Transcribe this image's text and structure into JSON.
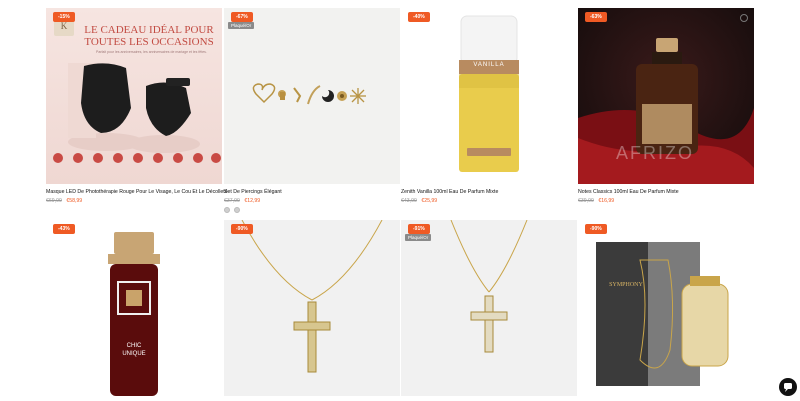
{
  "products": [
    {
      "discount": "-15%",
      "title": "Masque LED De Photothérapie Rouge Pour Le Visage, Le Cou Et Le Décolleté",
      "old_price": "€69,99",
      "new_price": "€58,99",
      "image_text": {
        "headline": "LE CADEAU IDÉAL POUR TOUTES LES OCCASIONS",
        "sub": "Parfait pour les anniversaires, les anniversaires de mariage et les fêtes."
      }
    },
    {
      "discount": "-67%",
      "tag": "Plaqué/Or",
      "title": "Set De Piercings Élégant",
      "old_price": "€37,99",
      "new_price": "€12,99"
    },
    {
      "discount": "-40%",
      "title": "Zenith Vanilla 100ml Eau De Parfum Mixte",
      "old_price": "€43,99",
      "new_price": "€25,99",
      "image_text": {
        "label": "VANILLA"
      }
    },
    {
      "discount": "-63%",
      "title": "Notes Classics 100ml Eau De Parfum Mixte",
      "old_price": "€39,99",
      "new_price": "€16,99",
      "image_text": {
        "watermark": "AFRIZO"
      }
    },
    {
      "discount": "-43%",
      "image_text": {
        "label1": "CHIC",
        "label2": "UNIQUE"
      }
    },
    {
      "discount": "-90%"
    },
    {
      "discount": "-91%",
      "tag": "Plaqué/Or"
    },
    {
      "discount": "-90%",
      "image_text": {
        "box_label": "SYMPHONY"
      }
    }
  ],
  "colors": {
    "accent": "#ef5a24",
    "price_new": "#ef5a24",
    "price_old": "#999999"
  },
  "icons": {
    "chat": "chat-bubble-icon"
  }
}
